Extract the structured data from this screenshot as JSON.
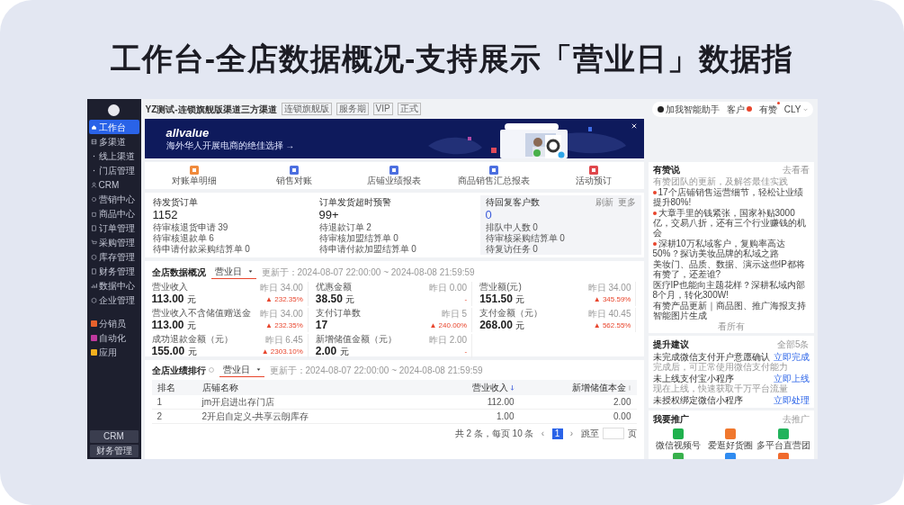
{
  "headline": "工作台-全店数据概况-支持展示「营业日」数据指",
  "sidebar": {
    "items": [
      {
        "label": "工作台",
        "kind": "home",
        "selected": true
      },
      {
        "label": "多渠道",
        "kind": "grid",
        "selected": false
      },
      {
        "label": "线上渠道",
        "kind": "dot",
        "selected": false
      },
      {
        "label": "门店管理",
        "kind": "dot",
        "selected": false
      },
      {
        "label": "CRM",
        "kind": "user",
        "selected": false
      },
      {
        "label": "营销中心",
        "kind": "gear",
        "selected": false
      },
      {
        "label": "商品中心",
        "kind": "bag",
        "selected": false
      },
      {
        "label": "订单管理",
        "kind": "doc",
        "selected": false
      },
      {
        "label": "采购管理",
        "kind": "cart",
        "selected": false
      },
      {
        "label": "库存管理",
        "kind": "box",
        "selected": false
      },
      {
        "label": "财务管理",
        "kind": "doc",
        "selected": false
      },
      {
        "label": "数据中心",
        "kind": "chart",
        "selected": false
      },
      {
        "label": "企业管理",
        "kind": "box",
        "selected": false
      }
    ],
    "extra_items": [
      {
        "label": "分销员",
        "color": "#e8622c"
      },
      {
        "label": "自动化",
        "color": "#c0399e"
      },
      {
        "label": "应用",
        "color": "#f2b01e"
      }
    ],
    "bottom_buttons": [
      "CRM",
      "财务管理"
    ]
  },
  "header": {
    "store_name": "YZ测试-连锁旗舰版渠道三方渠道",
    "tags": [
      "连锁旗舰版",
      "服务期",
      "VIP",
      "正式"
    ],
    "actions": [
      {
        "label": "加我智能助手",
        "kind": "assistant"
      },
      {
        "label": "客户",
        "kind": "badge"
      },
      {
        "label": "有赞",
        "kind": "dot"
      },
      {
        "label": "CLY",
        "kind": "menu"
      }
    ]
  },
  "banner": {
    "brand": "allvalue",
    "tagline": "海外华人开展电商的绝佳选择 →"
  },
  "shortcuts": [
    {
      "label": "对账单明细",
      "color": "#f08a3c"
    },
    {
      "label": "销售对账",
      "color": "#4c6fe0"
    },
    {
      "label": "店铺业绩报表",
      "color": "#4c6fe0"
    },
    {
      "label": "商品销售汇总报表",
      "color": "#4c6fe0"
    },
    {
      "label": "活动预订",
      "color": "#e0474c"
    }
  ],
  "todo_cards": [
    {
      "title": "待发货订单",
      "value": "1152",
      "highlight": false,
      "lines": [
        "待审核退货申请 39",
        "待审核退款单 6",
        "待申请付款采购结算单 0"
      ]
    },
    {
      "title": "订单发货超时预警",
      "value": "99+",
      "highlight": false,
      "lines": [
        "待退款订单 2",
        "待审核加盟结算单 0",
        "待申请付款加盟结算单 0"
      ]
    },
    {
      "title": "待回复客户数",
      "value": "0",
      "highlight": true,
      "links": [
        "刷新",
        "更多"
      ],
      "lines": [
        "排队中人数 0",
        "待审核采购结算单 0",
        "待复访任务 0"
      ]
    }
  ],
  "overview": {
    "title": "全店数据概况",
    "select": "营业日",
    "updated": "更新于：2024-08-07 22:00:00 ~ 2024-08-08 21:59:59",
    "metrics": [
      {
        "label": "营业收入",
        "value": "113.00",
        "unit": "元",
        "compare": "昨日 34.00",
        "change": "▲ 232.35%"
      },
      {
        "label": "优惠金额",
        "value": "38.50",
        "unit": "元",
        "compare": "昨日 0.00",
        "change": "-"
      },
      {
        "label": "营业额(元)",
        "value": "151.50",
        "unit": "元",
        "compare": "昨日 34.00",
        "change": "▲ 345.59%"
      },
      {
        "label": "营业收入不含储值赠送金",
        "value": "113.00",
        "unit": "元",
        "compare": "昨日 34.00",
        "change": "▲ 232.35%"
      },
      {
        "label": "支付订单数",
        "value": "17",
        "compare": "昨日 5",
        "change": "▲ 240.00%"
      },
      {
        "label": "支付金额（元）",
        "value": "268.00",
        "unit": "元",
        "compare": "昨日 40.45",
        "change": "▲ 562.55%"
      },
      {
        "label": "成功退款金额（元）",
        "value": "155.00",
        "unit": "元",
        "compare": "昨日 6.45",
        "change": "▲ 2303.10%"
      },
      {
        "label": "新增储值金额（元）",
        "value": "2.00",
        "unit": "元",
        "compare": "昨日 2.00",
        "change": "-"
      }
    ]
  },
  "ranking": {
    "title": "全店业绩排行",
    "select": "营业日",
    "updated": "更新于：2024-08-07 22:00:00 ~ 2024-08-08 21:59:59",
    "columns": [
      "排名",
      "店铺名称",
      "营业收入",
      "新增储值本金"
    ],
    "rows": [
      [
        "1",
        "jm开启进出存门店",
        "112.00",
        "2.00"
      ],
      [
        "2",
        "2开启自定义-共享云朗库存",
        "1.00",
        "0.00"
      ]
    ],
    "pagination": {
      "summary": "共 2 条，每页 10 条",
      "prev": "‹",
      "pages": [
        {
          "label": "1",
          "selected": true
        }
      ],
      "next": "›",
      "jump": "跳至",
      "unit": "页"
    }
  },
  "news": {
    "title": "有赞说",
    "link": "去看看",
    "subtitle": "有赞团队的更新，及解答最佳实践",
    "items": [
      {
        "text": "17个店铺销售运营细节，轻松让业绩提升80%!",
        "hot": true
      },
      {
        "text": "大章手里的钱紧张，国家补贴3000亿，交易八折，还有三个行业赚钱的机会",
        "hot": true
      },
      {
        "text": "深耕10万私域客户，复购率高达50%？探访美妆品牌的私域之路",
        "hot": true
      },
      {
        "text": "美妆门、品质、数据、演示这些IP都将有赞了，还差谁?",
        "hot": false
      },
      {
        "text": "医疗IP也能向主题花样？深耕私域内部8个月，转化300W!",
        "hot": false
      },
      {
        "text": "有赞产品更新｜商品图、推广海报支持智能图片生成",
        "hot": false
      }
    ],
    "more": "看所有"
  },
  "suggestions": {
    "title": "提升建议",
    "link": "全部5条",
    "items": [
      {
        "text": "未完成微信支付开户意愿确认",
        "action": "立即完成",
        "hint": "完成后，可正常使用微信支付能力"
      },
      {
        "text": "未上线支付宝小程序",
        "action": "立即上线",
        "hint": "现在上线，快速获取千万平台流量"
      },
      {
        "text": "未授权绑定微信小程序",
        "action": "立即处理"
      }
    ]
  },
  "promote": {
    "title": "我要推广",
    "link": "去推广",
    "apps": [
      {
        "label": "微信视频号",
        "color": "#1fb14d"
      },
      {
        "label": "爱逛好货圈",
        "color": "#f0772d"
      },
      {
        "label": "多平台直营团",
        "color": "#22b35c"
      }
    ],
    "more_apps": [
      {
        "color": "#38b14c"
      },
      {
        "color": "#2f8bf0"
      },
      {
        "color": "#f06a2d"
      }
    ]
  }
}
